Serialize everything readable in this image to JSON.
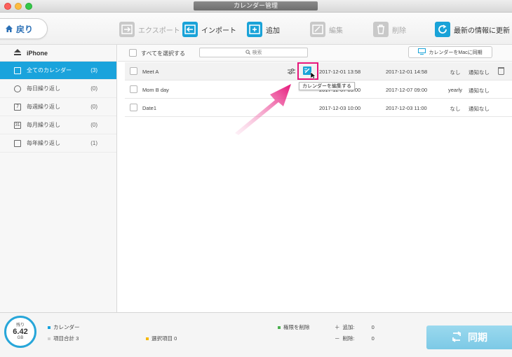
{
  "window": {
    "title": "カレンダー管理"
  },
  "toolbar": {
    "back_label": "戻り",
    "export_label": "エクスポート",
    "import_label": "インポート",
    "add_label": "追加",
    "edit_label": "編集",
    "delete_label": "削除",
    "refresh_label": "最新の情報に更新"
  },
  "sidebar": {
    "device": "iPhone",
    "items": [
      {
        "label": "全てのカレンダー",
        "count": "(3)",
        "icon": "calendar-icon"
      },
      {
        "label": "毎日繰り返し",
        "count": "(0)",
        "icon": "daily-icon"
      },
      {
        "label": "毎週繰り返し",
        "count": "(0)",
        "icon": "weekly-icon"
      },
      {
        "label": "毎月繰り返し",
        "count": "(0)",
        "icon": "monthly-icon"
      },
      {
        "label": "毎年繰り返し",
        "count": "(1)",
        "icon": "yearly-icon"
      }
    ]
  },
  "list": {
    "select_all": "すべてを選択する",
    "search_placeholder": "検索",
    "sync_mac": "カレンダーをMacに同期",
    "tooltip": "カレンダーを編集する",
    "rows": [
      {
        "event": "Meet A",
        "start": "2017-12-01 13:58",
        "end": "2017-12-01 14:58",
        "repeat": "なし",
        "alarm": "通知なし"
      },
      {
        "event": "Mom  B day",
        "start": "2017-12-07 09:00",
        "end": "2017-12-07 09:00",
        "repeat": "yearly",
        "alarm": "通知なし"
      },
      {
        "event": "Date1",
        "start": "2017-12-03 10:00",
        "end": "2017-12-03 11:00",
        "repeat": "なし",
        "alarm": "通知なし"
      }
    ]
  },
  "footer": {
    "storage_top": "残り",
    "storage_value": "6.42",
    "storage_unit": "GB",
    "calendar_label": "カレンダー",
    "total_label": "項目合計 3",
    "selected_label": "選択項目 0",
    "delete_perm_label": "権限を削除",
    "add_label": "追加:",
    "add_value": "0",
    "del_label": "削除:",
    "del_value": "0",
    "sync_label": "同期"
  },
  "colors": {
    "accent": "#1aa3dc",
    "highlight": "#e6157a",
    "sync_button": "#8dd1ea"
  }
}
